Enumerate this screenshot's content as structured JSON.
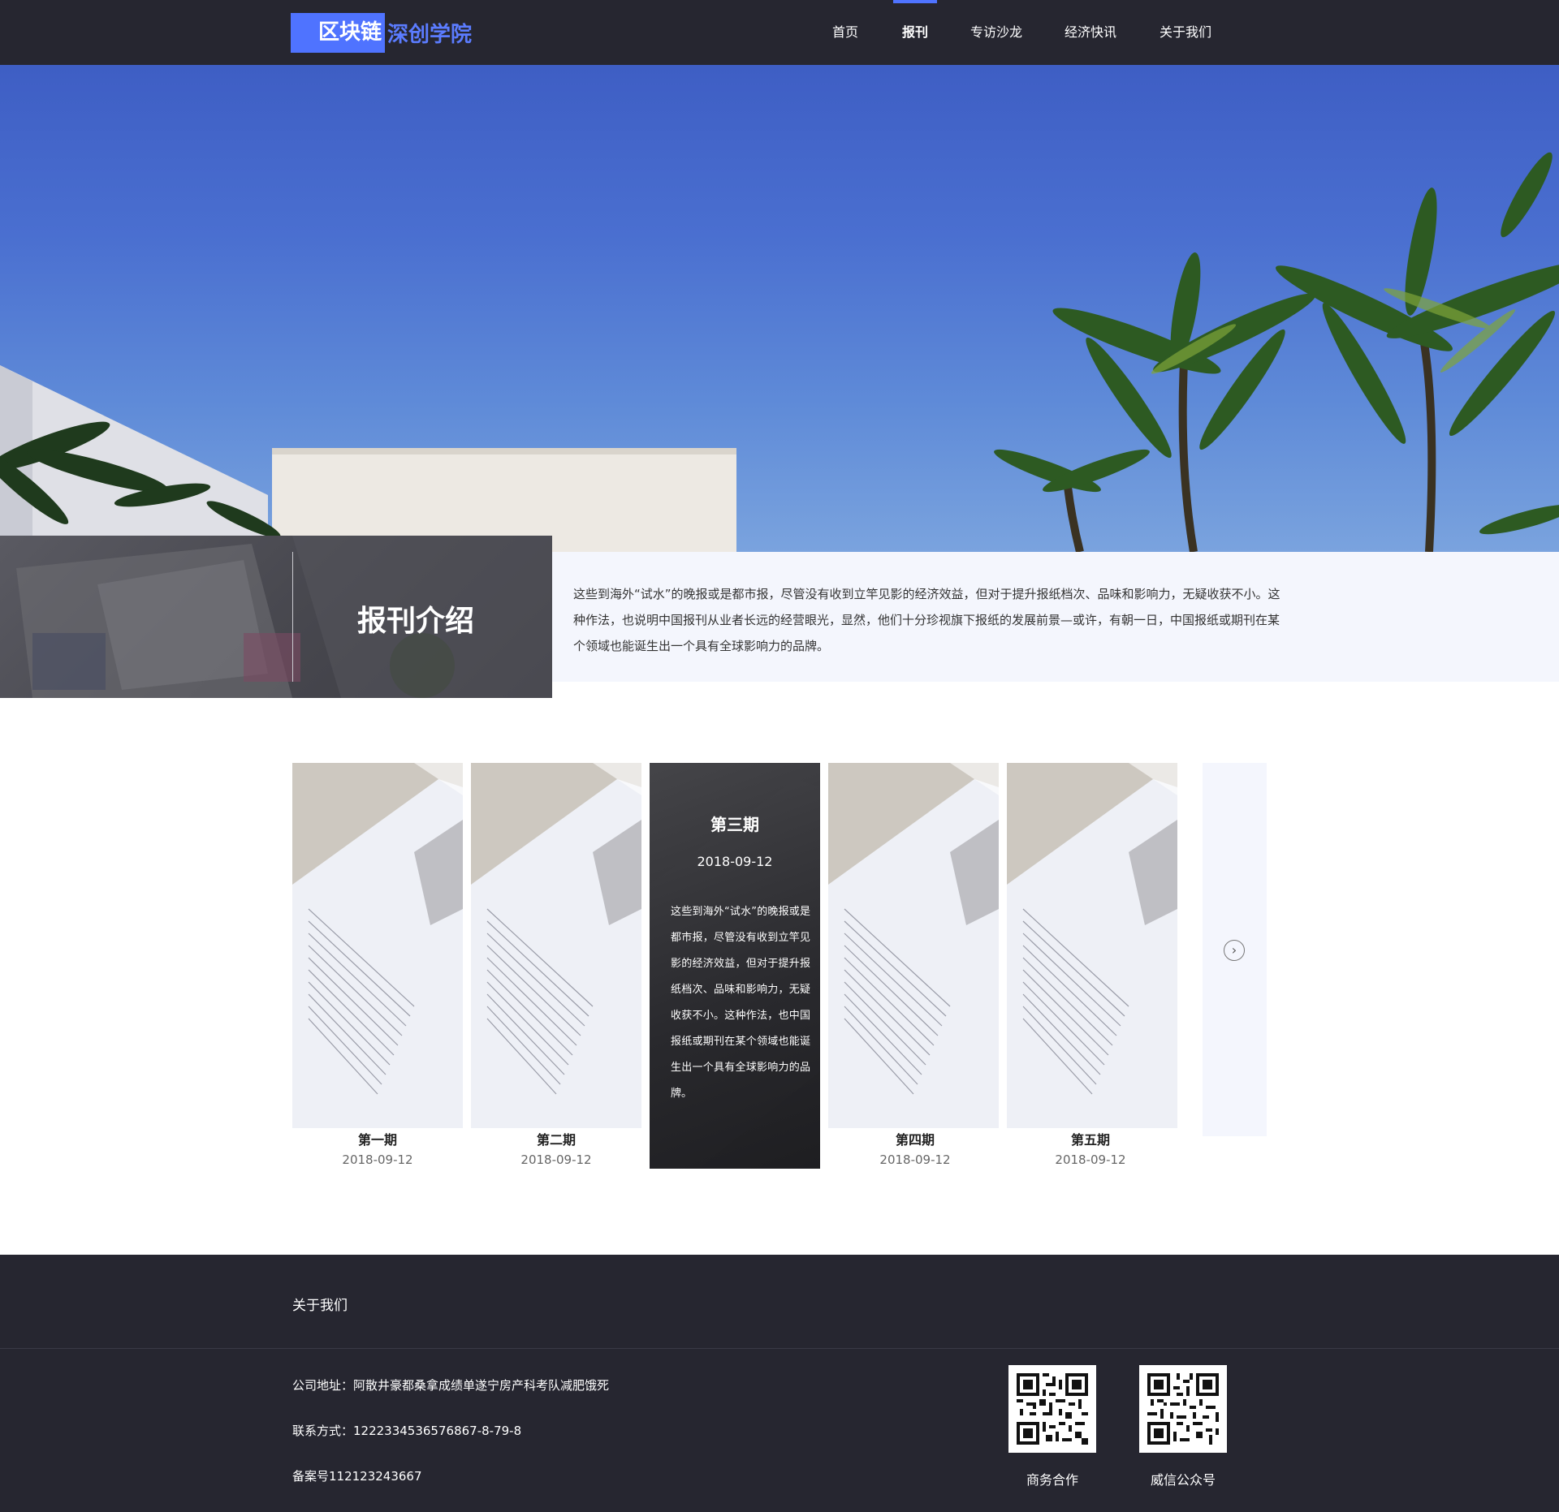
{
  "header": {
    "logo_primary": "区块链",
    "logo_secondary": "深创学院",
    "nav": [
      {
        "label": "首页"
      },
      {
        "label": "报刊",
        "active": true
      },
      {
        "label": "专访沙龙"
      },
      {
        "label": "经济快讯"
      },
      {
        "label": "关于我们"
      }
    ]
  },
  "intro": {
    "title": "报刊介绍",
    "text": "这些到海外“试水”的晚报或是都市报，尽管没有收到立竿见影的经济效益，但对于提升报纸档次、品味和影响力，无疑收获不小。这种作法，也说明中国报刊从业者长远的经营眼光，显然，他们十分珍视旗下报纸的发展前景—或许，有朝一日，中国报纸或期刊在某个领域也能诞生出一个具有全球影响力的品牌。"
  },
  "issues": [
    {
      "title": "第一期",
      "date": "2018-09-12"
    },
    {
      "title": "第二期",
      "date": "2018-09-12"
    },
    {
      "title": "第三期",
      "date": "2018-09-12",
      "active": true,
      "desc": "这些到海外“试水”的晚报或是都市报，尽管没有收到立竿见影的经济效益，但对于提升报纸档次、品味和影响力，无疑收获不小。这种作法，也中国报纸或期刊在某个领域也能诞生出一个具有全球影响力的品牌。"
    },
    {
      "title": "第四期",
      "date": "2018-09-12"
    },
    {
      "title": "第五期",
      "date": "2018-09-12"
    }
  ],
  "carousel": {
    "next_icon": "chevron-right-circle-icon"
  },
  "footer": {
    "about_label": "关于我们",
    "address": "公司地址：阿散井豪都桑拿成绩单遂宁房产科考队减肥饿死",
    "contact": "联系方式：1222334536576867-8-79-8",
    "icp": "备案号112123243667",
    "qr_codes": [
      {
        "label": "商务合作"
      },
      {
        "label": "威信公众号"
      }
    ]
  },
  "colors": {
    "accent": "#4f73ff",
    "dark_bg": "#262630",
    "light_panel": "#f4f6fd"
  }
}
